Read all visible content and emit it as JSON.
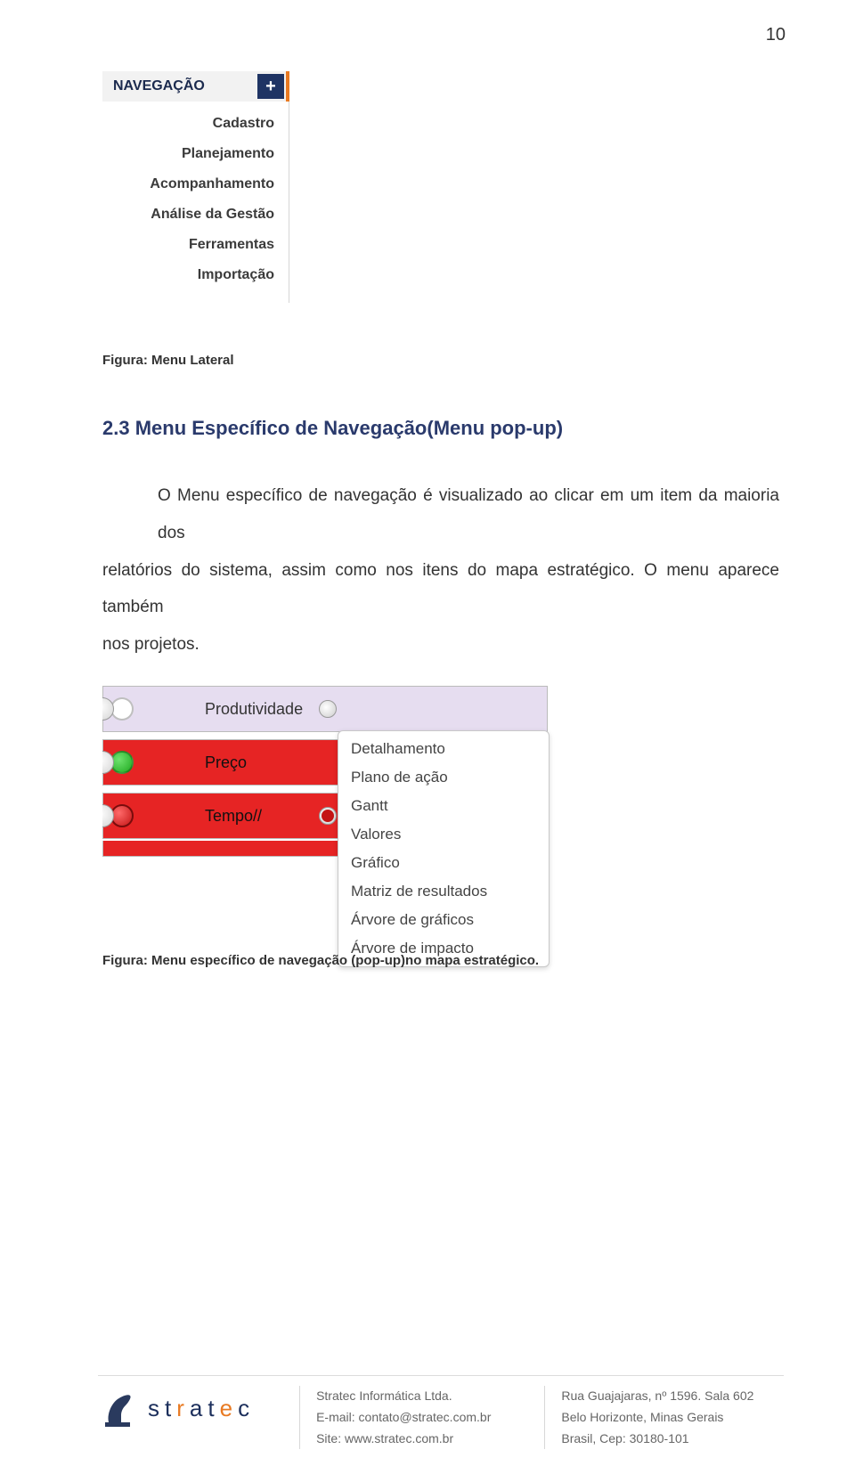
{
  "page_number": "10",
  "sidebar": {
    "header": "NAVEGAÇÃO",
    "plus_icon": "+",
    "items": [
      "Cadastro",
      "Planejamento",
      "Acompanhamento",
      "Análise da Gestão",
      "Ferramentas",
      "Importação"
    ]
  },
  "captions": {
    "fig1_prefix": "Figura: ",
    "fig1_text": "Menu Lateral",
    "fig2_prefix": "Figura: ",
    "fig2_text": "Menu específico de navegação (pop-up)no mapa estratégico."
  },
  "section": {
    "heading": "2.3 Menu Específico de Navegação(Menu pop-up)"
  },
  "paragraph": {
    "line1": "O Menu específico de navegação é visualizado ao clicar em um item da maioria dos",
    "line2": "relatórios do sistema, assim como nos itens do mapa estratégico. O menu aparece também",
    "line3": "nos projetos."
  },
  "popup": {
    "rows": [
      {
        "label": "Produtividade"
      },
      {
        "label": "Preço"
      },
      {
        "label": "Tempo//"
      }
    ],
    "menu_items": [
      "Detalhamento",
      "Plano de ação",
      "Gantt",
      "Valores",
      "Gráfico",
      "Matriz de resultados",
      "Árvore de gráficos",
      "Árvore de impacto"
    ]
  },
  "footer": {
    "brand_letters": [
      "s",
      "t",
      "r",
      "a",
      "t",
      "e",
      "c"
    ],
    "col1": {
      "l1": "Stratec Informática Ltda.",
      "l2": "E-mail: contato@stratec.com.br",
      "l3": "Site: www.stratec.com.br"
    },
    "col2": {
      "l1": "Rua Guajajaras, nº 1596. Sala 602",
      "l2": "Belo Horizonte, Minas Gerais",
      "l3": "Brasil, Cep: 30180-101"
    }
  }
}
